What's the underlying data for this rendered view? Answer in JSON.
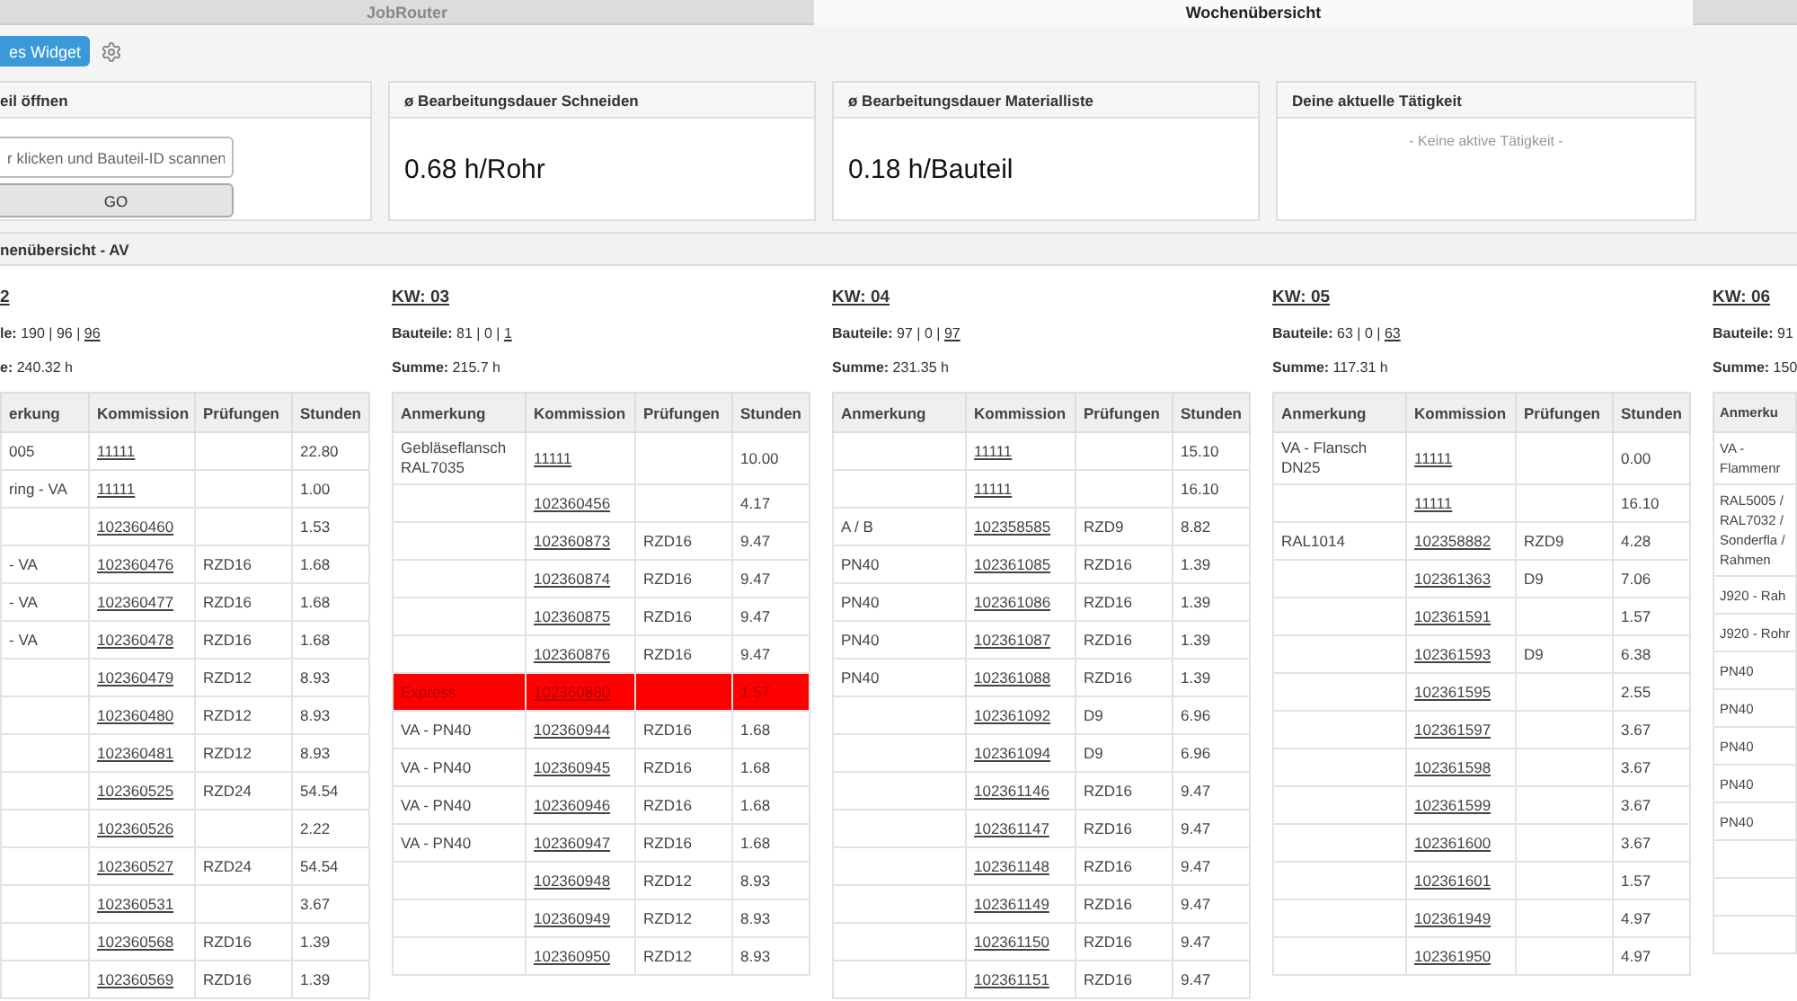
{
  "tabs": [
    {
      "label": "JobRouter",
      "selected": false
    },
    {
      "label": "Wochenübersicht",
      "selected": true
    },
    {
      "selected": false
    }
  ],
  "toolbar": {
    "add_widget_button": "es Widget"
  },
  "widgets": [
    {
      "kind": "scan",
      "title": "eil öffnen",
      "placeholder": "r klicken und Bauteil-ID scannen",
      "button": "GO"
    },
    {
      "kind": "metric",
      "title": "ø Bearbeitungsdauer Schneiden",
      "value": "0.68 h/Rohr"
    },
    {
      "kind": "metric",
      "title": "ø Bearbeitungsdauer Materialliste",
      "value": "0.18 h/Bauteil"
    },
    {
      "kind": "activity",
      "title": "Deine aktuelle Tätigkeit",
      "message": "- Keine aktive Tätigkeit -"
    }
  ],
  "section": {
    "title": "nenübersicht - AV",
    "weeks": [
      {
        "title": "2",
        "parts": {
          "label": "le:",
          "value": "190 | 96 |",
          "link": "96"
        },
        "sum": {
          "label": "e:",
          "value": "240.32 h"
        },
        "columns": [
          "erkung",
          "Kommission",
          "Prüfungen",
          "Stunden"
        ],
        "rows": [
          {
            "highlighted": false,
            "note": "005",
            "commission": "11111",
            "hours": "22.80"
          },
          {
            "highlighted": false,
            "note": "ring - VA",
            "commission": "11111",
            "hours": "1.00"
          },
          {
            "highlighted": false,
            "commission": "102360460",
            "hours": "1.53"
          },
          {
            "highlighted": false,
            "note": "- VA",
            "commission": "102360476",
            "tests": "RZD16",
            "hours": "1.68"
          },
          {
            "highlighted": false,
            "note": "- VA",
            "commission": "102360477",
            "tests": "RZD16",
            "hours": "1.68"
          },
          {
            "highlighted": false,
            "note": "- VA",
            "commission": "102360478",
            "tests": "RZD16",
            "hours": "1.68"
          },
          {
            "highlighted": false,
            "commission": "102360479",
            "tests": "RZD12",
            "hours": "8.93"
          },
          {
            "highlighted": false,
            "commission": "102360480",
            "tests": "RZD12",
            "hours": "8.93"
          },
          {
            "highlighted": false,
            "commission": "102360481",
            "tests": "RZD12",
            "hours": "8.93"
          },
          {
            "highlighted": false,
            "commission": "102360525",
            "tests": "RZD24",
            "hours": "54.54"
          },
          {
            "highlighted": false,
            "commission": "102360526",
            "hours": "2.22"
          },
          {
            "highlighted": false,
            "commission": "102360527",
            "tests": "RZD24",
            "hours": "54.54"
          },
          {
            "highlighted": false,
            "commission": "102360531",
            "hours": "3.67"
          },
          {
            "highlighted": false,
            "commission": "102360568",
            "tests": "RZD16",
            "hours": "1.39"
          },
          {
            "highlighted": false,
            "commission": "102360569",
            "tests": "RZD16",
            "hours": "1.39"
          }
        ]
      },
      {
        "title": "KW: 03",
        "parts": {
          "label": "Bauteile:",
          "value": "81 | 0 |",
          "link": "1"
        },
        "sum": {
          "label": "Summe:",
          "value": "215.7 h"
        },
        "columns": [
          "Anmerkung",
          "Kommission",
          "Prüfungen",
          "Stunden"
        ],
        "rows": [
          {
            "highlighted": false,
            "note": "Gebläseflansch RAL7035",
            "commission": "11111",
            "hours": "10.00"
          },
          {
            "highlighted": false,
            "commission": "102360456",
            "hours": "4.17"
          },
          {
            "highlighted": false,
            "commission": "102360873",
            "tests": "RZD16",
            "hours": "9.47"
          },
          {
            "highlighted": false,
            "commission": "102360874",
            "tests": "RZD16",
            "hours": "9.47"
          },
          {
            "highlighted": false,
            "commission": "102360875",
            "tests": "RZD16",
            "hours": "9.47"
          },
          {
            "highlighted": false,
            "commission": "102360876",
            "tests": "RZD16",
            "hours": "9.47"
          },
          {
            "highlighted": true,
            "note": "Express",
            "commission": "102360880",
            "hours": "1.57"
          },
          {
            "highlighted": false,
            "note": "VA - PN40",
            "commission": "102360944",
            "tests": "RZD16",
            "hours": "1.68"
          },
          {
            "highlighted": false,
            "note": "VA - PN40",
            "commission": "102360945",
            "tests": "RZD16",
            "hours": "1.68"
          },
          {
            "highlighted": false,
            "note": "VA - PN40",
            "commission": "102360946",
            "tests": "RZD16",
            "hours": "1.68"
          },
          {
            "highlighted": false,
            "note": "VA - PN40",
            "commission": "102360947",
            "tests": "RZD16",
            "hours": "1.68"
          },
          {
            "highlighted": false,
            "commission": "102360948",
            "tests": "RZD12",
            "hours": "8.93"
          },
          {
            "highlighted": false,
            "commission": "102360949",
            "tests": "RZD12",
            "hours": "8.93"
          },
          {
            "highlighted": false,
            "commission": "102360950",
            "tests": "RZD12",
            "hours": "8.93"
          }
        ]
      },
      {
        "title": "KW: 04",
        "parts": {
          "label": "Bauteile:",
          "value": "97 | 0 |",
          "link": "97"
        },
        "sum": {
          "label": "Summe:",
          "value": "231.35 h"
        },
        "columns": [
          "Anmerkung",
          "Kommission",
          "Prüfungen",
          "Stunden"
        ],
        "rows": [
          {
            "highlighted": false,
            "commission": "11111",
            "hours": "15.10"
          },
          {
            "highlighted": false,
            "commission": "11111",
            "hours": "16.10"
          },
          {
            "highlighted": false,
            "note": "A / B",
            "commission": "102358585",
            "tests": "RZD9",
            "hours": "8.82"
          },
          {
            "highlighted": false,
            "note": "PN40",
            "commission": "102361085",
            "tests": "RZD16",
            "hours": "1.39"
          },
          {
            "highlighted": false,
            "note": "PN40",
            "commission": "102361086",
            "tests": "RZD16",
            "hours": "1.39"
          },
          {
            "highlighted": false,
            "note": "PN40",
            "commission": "102361087",
            "tests": "RZD16",
            "hours": "1.39"
          },
          {
            "highlighted": false,
            "note": "PN40",
            "commission": "102361088",
            "tests": "RZD16",
            "hours": "1.39"
          },
          {
            "highlighted": false,
            "commission": "102361092",
            "tests": "D9",
            "hours": "6.96"
          },
          {
            "highlighted": false,
            "commission": "102361094",
            "tests": "D9",
            "hours": "6.96"
          },
          {
            "highlighted": false,
            "commission": "102361146",
            "tests": "RZD16",
            "hours": "9.47"
          },
          {
            "highlighted": false,
            "commission": "102361147",
            "tests": "RZD16",
            "hours": "9.47"
          },
          {
            "highlighted": false,
            "commission": "102361148",
            "tests": "RZD16",
            "hours": "9.47"
          },
          {
            "highlighted": false,
            "commission": "102361149",
            "tests": "RZD16",
            "hours": "9.47"
          },
          {
            "highlighted": false,
            "commission": "102361150",
            "tests": "RZD16",
            "hours": "9.47"
          },
          {
            "highlighted": false,
            "commission": "102361151",
            "tests": "RZD16",
            "hours": "9.47"
          }
        ]
      },
      {
        "title": "KW: 05",
        "parts": {
          "label": "Bauteile:",
          "value": "63 | 0 |",
          "link": "63"
        },
        "sum": {
          "label": "Summe:",
          "value": "117.31 h"
        },
        "columns": [
          "Anmerkung",
          "Kommission",
          "Prüfungen",
          "Stunden"
        ],
        "rows": [
          {
            "highlighted": false,
            "note": "VA - Flansch DN25",
            "commission": "11111",
            "hours": "0.00"
          },
          {
            "highlighted": false,
            "commission": "11111",
            "hours": "16.10"
          },
          {
            "highlighted": false,
            "note": "RAL1014",
            "commission": "102358882",
            "tests": "RZD9",
            "hours": "4.28"
          },
          {
            "highlighted": false,
            "commission": "102361363",
            "tests": "D9",
            "hours": "7.06"
          },
          {
            "highlighted": false,
            "commission": "102361591",
            "hours": "1.57"
          },
          {
            "highlighted": false,
            "commission": "102361593",
            "tests": "D9",
            "hours": "6.38"
          },
          {
            "highlighted": false,
            "commission": "102361595",
            "hours": "2.55"
          },
          {
            "highlighted": false,
            "commission": "102361597",
            "hours": "3.67"
          },
          {
            "highlighted": false,
            "commission": "102361598",
            "hours": "3.67"
          },
          {
            "highlighted": false,
            "commission": "102361599",
            "hours": "3.67"
          },
          {
            "highlighted": false,
            "commission": "102361600",
            "hours": "3.67"
          },
          {
            "highlighted": false,
            "commission": "102361601",
            "hours": "1.57"
          },
          {
            "highlighted": false,
            "commission": "102361949",
            "hours": "4.97"
          },
          {
            "highlighted": false,
            "commission": "102361950",
            "hours": "4.97"
          }
        ]
      },
      {
        "title": "KW: 06",
        "parts": {
          "label": "Bauteile:",
          "value": "91"
        },
        "sum": {
          "label": "Summe:",
          "value": "150"
        },
        "columns": [
          "Anmerku"
        ],
        "rows": [
          {
            "highlighted": false,
            "note": "VA - Flammenr"
          },
          {
            "highlighted": false,
            "note": "RAL5005 / RAL7032 / Sonderfla / Rahmen"
          },
          {
            "highlighted": false,
            "note": "J920 - Rah"
          },
          {
            "highlighted": false,
            "note": "J920 - Rohr"
          },
          {
            "highlighted": false,
            "note": "PN40"
          },
          {
            "highlighted": false,
            "note": "PN40"
          },
          {
            "highlighted": false,
            "note": "PN40"
          },
          {
            "highlighted": false,
            "note": "PN40"
          },
          {
            "highlighted": false,
            "note": "PN40"
          },
          {
            "highlighted": false
          },
          {
            "highlighted": false
          },
          {
            "highlighted": false
          }
        ]
      }
    ]
  }
}
